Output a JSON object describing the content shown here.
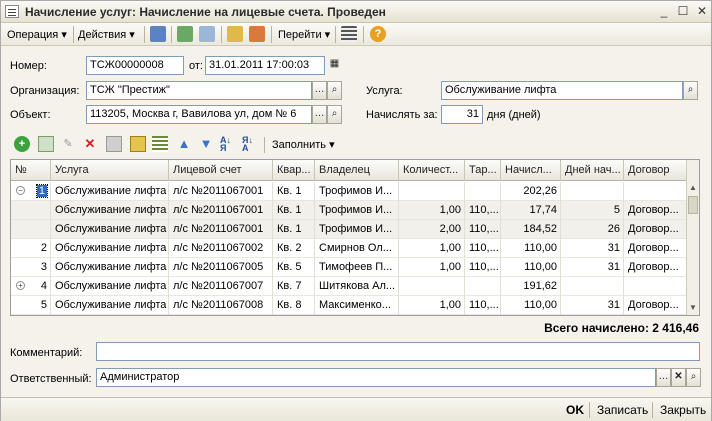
{
  "window": {
    "title": "Начисление услуг: Начисление на лицевые счета. Проведен"
  },
  "toolbar": {
    "operation": "Операция",
    "actions": "Действия",
    "goto": "Перейти"
  },
  "form": {
    "number_label": "Номер:",
    "number_value": "ТСЖ00000008",
    "date_label": "от:",
    "date_value": "31.01.2011 17:00:03",
    "org_label": "Организация:",
    "org_value": "ТСЖ \"Престиж\"",
    "service_label": "Услуга:",
    "service_value": "Обслуживание лифта",
    "object_label": "Объект:",
    "object_value": "113205, Москва г, Вавилова ул, дом № 6",
    "days_label": "Начислять за:",
    "days_value": "31",
    "days_unit": "дня (дней)"
  },
  "table_toolbar": {
    "fill": "Заполнить"
  },
  "grid": {
    "headers": [
      "№",
      "Услуга",
      "Лицевой счет",
      "Квар...",
      "Владелец",
      "Количест...",
      "Тар...",
      "Начисл...",
      "Дней нач...",
      "Договор"
    ],
    "rows": [
      {
        "num": "1",
        "service": "Обслуживание лифта",
        "account": "л/с №2011067001",
        "apt": "Кв. 1",
        "owner": "Трофимов И...",
        "qty": "",
        "tariff": "",
        "amount": "202,26",
        "days": "",
        "contract": "",
        "expander": "−",
        "selected": true,
        "sub": false
      },
      {
        "num": "",
        "service": "Обслуживание лифта",
        "account": "л/с №2011067001",
        "apt": "Кв. 1",
        "owner": "Трофимов И...",
        "qty": "1,00",
        "tariff": "110,...",
        "amount": "17,74",
        "days": "5",
        "contract": "Договор...",
        "expander": "",
        "selected": false,
        "sub": true
      },
      {
        "num": "",
        "service": "Обслуживание лифта",
        "account": "л/с №2011067001",
        "apt": "Кв. 1",
        "owner": "Трофимов И...",
        "qty": "2,00",
        "tariff": "110,...",
        "amount": "184,52",
        "days": "26",
        "contract": "Договор...",
        "expander": "",
        "selected": false,
        "sub": true
      },
      {
        "num": "2",
        "service": "Обслуживание лифта",
        "account": "л/с №2011067002",
        "apt": "Кв. 2",
        "owner": "Смирнов Ол...",
        "qty": "1,00",
        "tariff": "110,...",
        "amount": "110,00",
        "days": "31",
        "contract": "Договор...",
        "expander": "",
        "selected": false,
        "sub": false
      },
      {
        "num": "3",
        "service": "Обслуживание лифта",
        "account": "л/с №2011067005",
        "apt": "Кв. 5",
        "owner": "Тимофеев П...",
        "qty": "1,00",
        "tariff": "110,...",
        "amount": "110,00",
        "days": "31",
        "contract": "Договор...",
        "expander": "",
        "selected": false,
        "sub": false
      },
      {
        "num": "4",
        "service": "Обслуживание лифта",
        "account": "л/с №2011067007",
        "apt": "Кв. 7",
        "owner": "Шитякова Ал...",
        "qty": "",
        "tariff": "",
        "amount": "191,62",
        "days": "",
        "contract": "",
        "expander": "+",
        "selected": false,
        "sub": false
      },
      {
        "num": "5",
        "service": "Обслуживание лифта",
        "account": "л/с №2011067008",
        "apt": "Кв. 8",
        "owner": "Максименко...",
        "qty": "1,00",
        "tariff": "110,...",
        "amount": "110,00",
        "days": "31",
        "contract": "Договор...",
        "expander": "",
        "selected": false,
        "sub": false
      }
    ]
  },
  "total": "Всего начислено: 2 416,46",
  "comment_label": "Комментарий:",
  "comment_value": "",
  "responsible_label": "Ответственный:",
  "responsible_value": "Администратор",
  "bottom": {
    "ok": "OK",
    "save": "Записать",
    "close": "Закрыть"
  }
}
